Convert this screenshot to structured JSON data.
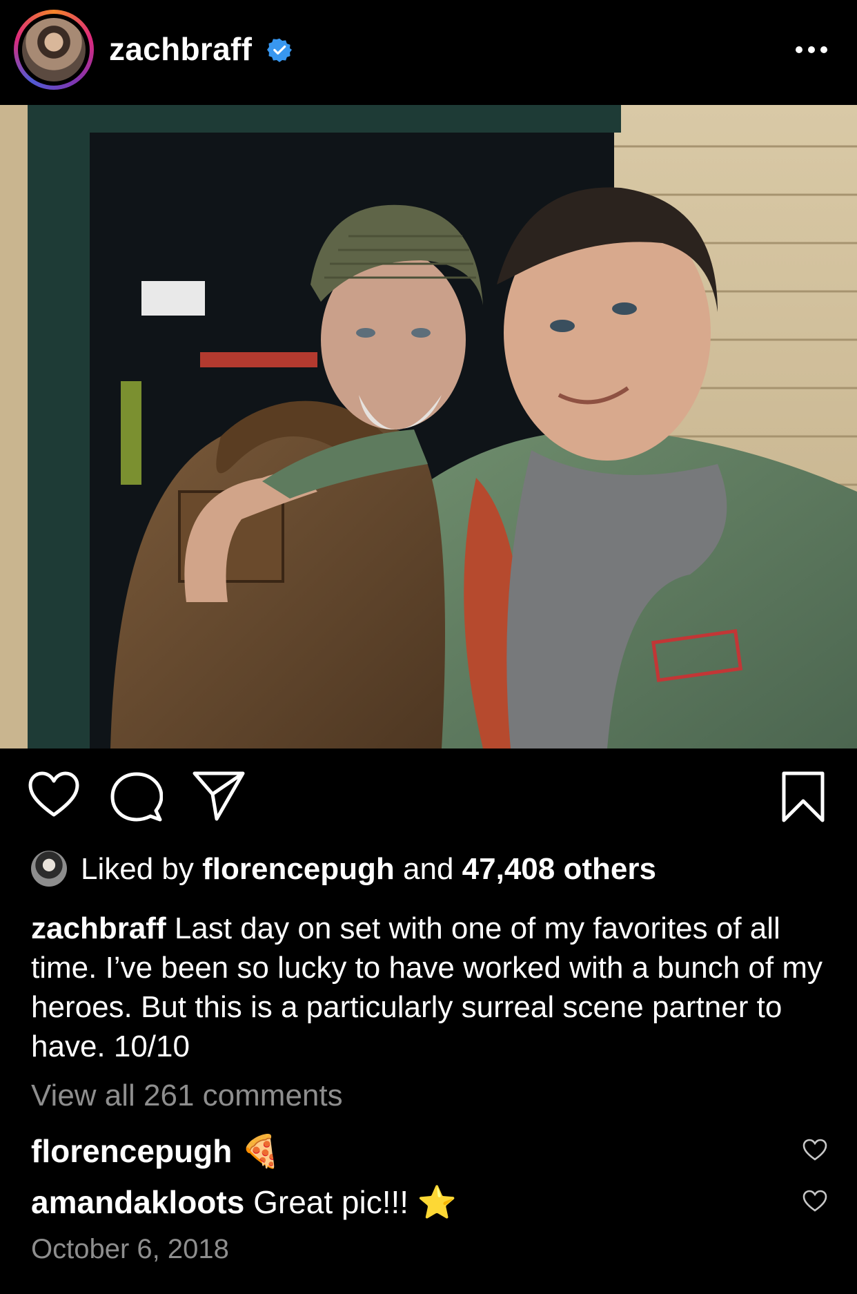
{
  "post": {
    "username": "zachbraff",
    "verified": true,
    "more_icon": "more-horizontal-icon",
    "photo_description_icon": "post-photo",
    "actions": {
      "like_icon": "heart-icon",
      "comment_icon": "comment-icon",
      "share_icon": "send-icon",
      "save_icon": "bookmark-icon"
    },
    "likes": {
      "prefix": "Liked by ",
      "liker": "florencepugh",
      "middle": " and ",
      "others": "47,408 others"
    },
    "caption": {
      "username": "zachbraff",
      "text": " Last day on set with one of my favorites of all time. I’ve been so lucky to have worked with a bunch of my heroes. But this is a particularly surreal scene partner to have. 10/10"
    },
    "view_all_comments": "View all 261 comments",
    "comments": [
      {
        "username": "florencepugh",
        "text": " ",
        "emoji": "🍕"
      },
      {
        "username": "amandakloots",
        "text": " Great pic!!! ",
        "emoji": "⭐"
      }
    ],
    "date": "October 6, 2018"
  },
  "colors": {
    "background": "#000000",
    "text": "#ffffff",
    "muted": "#8e8e8e",
    "verified": "#3897f0"
  }
}
